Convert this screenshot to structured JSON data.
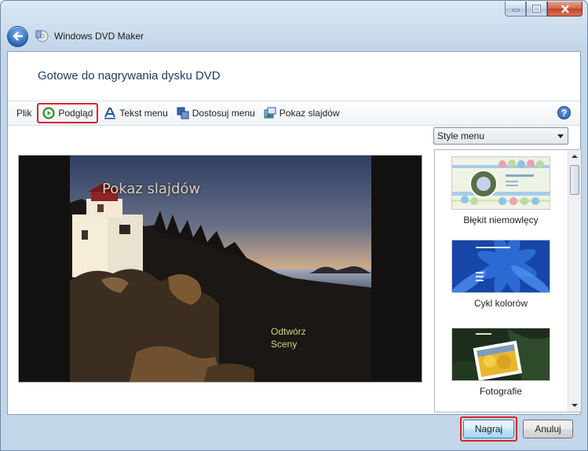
{
  "window": {
    "app_title": "Windows DVD Maker",
    "heading": "Gotowe do nagrywania dysku DVD"
  },
  "toolbar": {
    "file": "Plik",
    "preview": "Podgląd",
    "menu_text": "Tekst menu",
    "customize_menu": "Dostosuj menu",
    "slideshow": "Pokaz slajdów"
  },
  "preview": {
    "menu_title": "Pokaz slajdów",
    "play": "Odtwórz",
    "scenes": "Sceny"
  },
  "styles": {
    "dropdown_value": "Style menu",
    "items": [
      {
        "label": "Błękit niemowlęcy"
      },
      {
        "label": "Cykl kolorów"
      },
      {
        "label": "Fotografie"
      }
    ]
  },
  "buttons": {
    "burn": "Nagraj",
    "cancel": "Anuluj"
  },
  "colors": {
    "highlight": "#d8282b",
    "accent": "#2a66b8"
  }
}
